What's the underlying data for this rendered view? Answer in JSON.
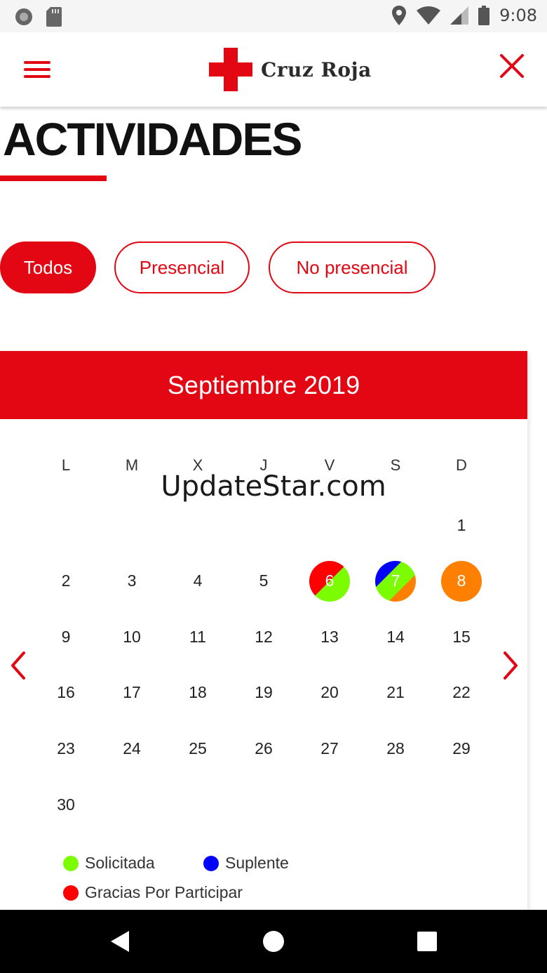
{
  "status_bar": {
    "time": "9:08",
    "icons": [
      "record-icon",
      "sd-card-icon",
      "location-icon",
      "wifi-icon",
      "signal-icon",
      "battery-icon"
    ]
  },
  "app_bar": {
    "logo_text": "Cruz Roja",
    "brand_color": "#e30613"
  },
  "page": {
    "title": "ACTIVIDADES"
  },
  "filters": [
    {
      "label": "Todos",
      "active": true
    },
    {
      "label": "Presencial",
      "active": false
    },
    {
      "label": "No presencial",
      "active": false
    }
  ],
  "calendar": {
    "month_label": "Septiembre 2019",
    "weekdays": [
      "L",
      "M",
      "X",
      "J",
      "V",
      "S",
      "D"
    ],
    "first_weekday_index": 6,
    "days_in_month": 30,
    "marked_days": [
      {
        "day": 6,
        "colors": [
          "#ff0000",
          "#7cfc00"
        ]
      },
      {
        "day": 7,
        "colors": [
          "#0000ff",
          "#7cfc00",
          "#ff7f00"
        ]
      },
      {
        "day": 8,
        "colors": [
          "#ff7f00"
        ]
      }
    ]
  },
  "watermark": "UpdateStar.com",
  "legend": [
    {
      "label": "Solicitada",
      "color": "#7cfc00"
    },
    {
      "label": "Suplente",
      "color": "#0000ff"
    },
    {
      "label": "Gracias Por Participar",
      "color": "#ff0000"
    }
  ]
}
